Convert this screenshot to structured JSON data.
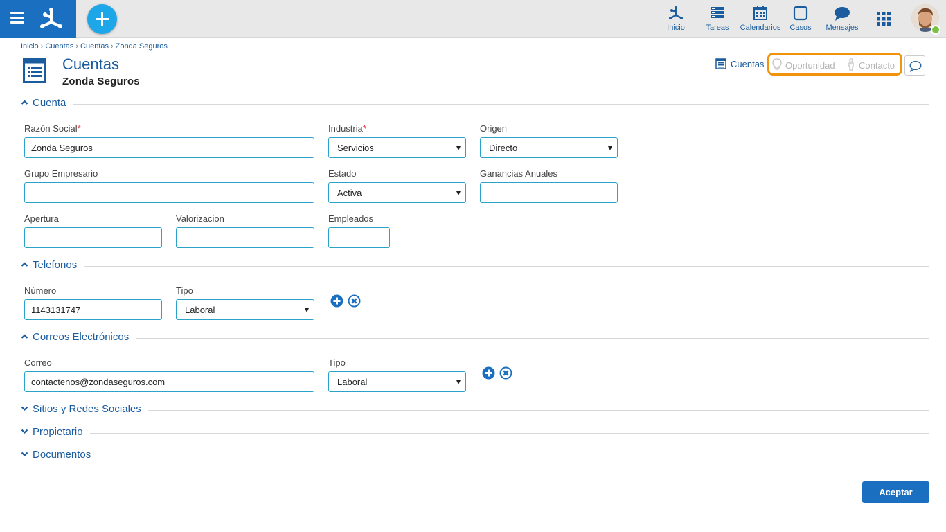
{
  "topbar": {
    "nav": [
      {
        "label": "Inicio",
        "icon": "home-network-icon"
      },
      {
        "label": "Tareas",
        "icon": "tasks-icon"
      },
      {
        "label": "Calendarios",
        "icon": "calendar-icon"
      },
      {
        "label": "Casos",
        "icon": "cases-icon"
      },
      {
        "label": "Mensajes",
        "icon": "messages-icon"
      }
    ]
  },
  "breadcrumb": [
    "Inicio",
    "Cuentas",
    "Cuentas",
    "Zonda Seguros"
  ],
  "header": {
    "title": "Cuentas",
    "subtitle": "Zonda Seguros",
    "links": {
      "cuentas": "Cuentas",
      "oportunidad": "Oportunidad",
      "contacto": "Contacto"
    },
    "highlight_color": "#f2930c"
  },
  "sections": {
    "cuenta": "Cuenta",
    "telefonos": "Telefonos",
    "correos": "Correos Electrónicos",
    "sitios": "Sitios y Redes Sociales",
    "propietario": "Propietario",
    "documentos": "Documentos"
  },
  "cuenta": {
    "razon_social": {
      "label": "Razón Social",
      "required": "*",
      "value": "Zonda Seguros"
    },
    "industria": {
      "label": "Industria",
      "required": "*",
      "value": "Servicios"
    },
    "origen": {
      "label": "Origen",
      "value": "Directo"
    },
    "grupo_empresario": {
      "label": "Grupo Empresario",
      "value": ""
    },
    "estado": {
      "label": "Estado",
      "value": "Activa"
    },
    "ganancias_anuales": {
      "label": "Ganancias Anuales",
      "value": ""
    },
    "apertura": {
      "label": "Apertura",
      "value": ""
    },
    "valorizacion": {
      "label": "Valorizacion",
      "value": ""
    },
    "empleados": {
      "label": "Empleados",
      "value": ""
    }
  },
  "telefonos": {
    "numero": {
      "label": "Número",
      "value": "1143131747"
    },
    "tipo": {
      "label": "Tipo",
      "value": "Laboral"
    }
  },
  "correos": {
    "correo": {
      "label": "Correo",
      "value": "contactenos@zondaseguros.com"
    },
    "tipo": {
      "label": "Tipo",
      "value": "Laboral"
    }
  },
  "footer": {
    "accept_label": "Aceptar"
  },
  "colors": {
    "brand": "#1a6fc0",
    "accent": "#1ea7e8",
    "link": "#1a5c9e",
    "field_border": "#2ba3c9",
    "online": "#7cc242"
  }
}
